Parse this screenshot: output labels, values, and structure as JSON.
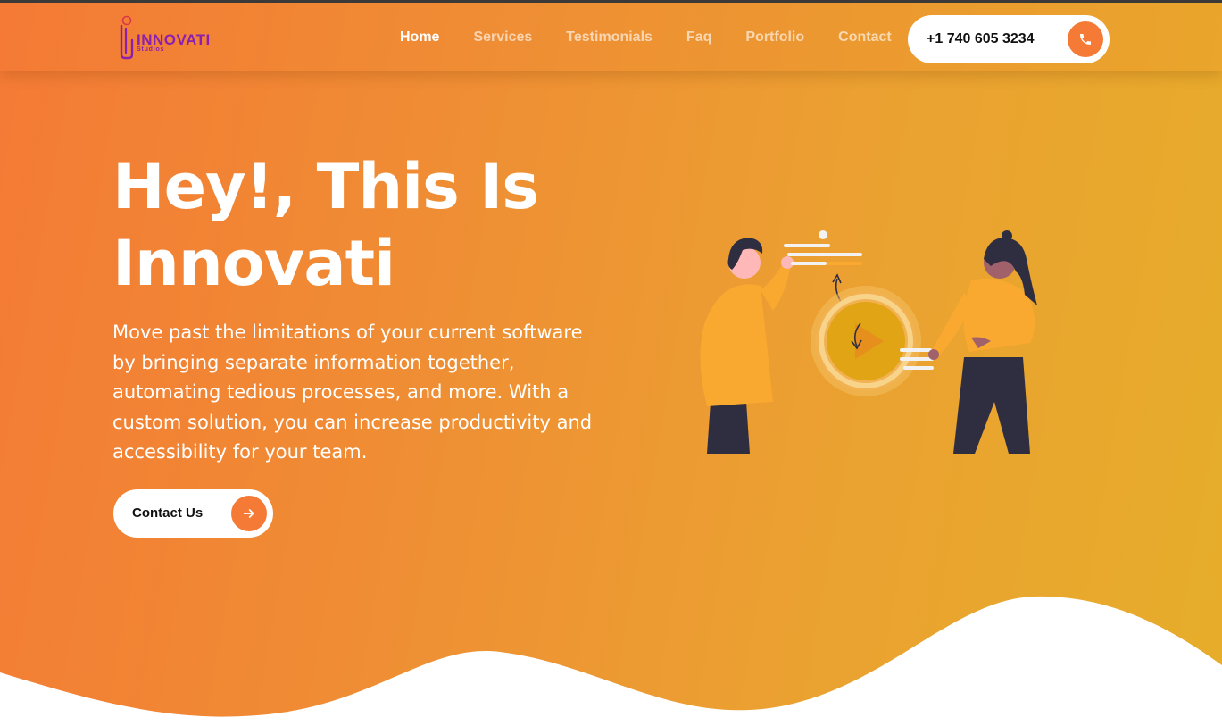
{
  "brand": {
    "name": "INNOVATI",
    "sub": "Studios"
  },
  "nav": {
    "links": [
      {
        "label": "Home",
        "active": true
      },
      {
        "label": "Services",
        "active": false
      },
      {
        "label": "Testimonials",
        "active": false
      },
      {
        "label": "Faq",
        "active": false
      },
      {
        "label": "Portfolio",
        "active": false
      },
      {
        "label": "Contact",
        "active": false
      }
    ],
    "phone": "+1 740 605 3234",
    "phone_icon": "phone-icon"
  },
  "hero": {
    "headline_line1": "Hey!, This Is",
    "headline_line2": "Innovati",
    "description": "Move past the limitations of your current software by bringing separate information together, automating tedious processes, and more. With a custom solution, you can increase productivity and accessibility for your team.",
    "cta_label": "Contact Us",
    "cta_icon": "arrow-right-icon"
  },
  "colors": {
    "gradient_start": "#f47a35",
    "gradient_end": "#e6ad2a",
    "accent": "#f47a35",
    "brand_purple": "#8b1fb0",
    "white": "#ffffff"
  }
}
